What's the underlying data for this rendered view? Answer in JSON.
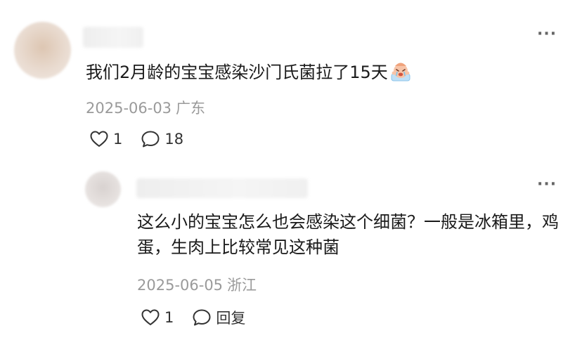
{
  "comment": {
    "text": "我们2月龄的宝宝感染沙门氏菌拉了15天",
    "date": "2025-06-03",
    "location": "广东",
    "likes": "1",
    "replies": "18",
    "emoji_icon": "crying-face-icon"
  },
  "reply": {
    "text": "这么小的宝宝怎么也会感染这个细菌？一般是冰箱里，鸡蛋，生肉上比较常见这种菌",
    "date": "2025-06-05",
    "location": "浙江",
    "likes": "1",
    "reply_label": "回复"
  },
  "more_label": "···"
}
